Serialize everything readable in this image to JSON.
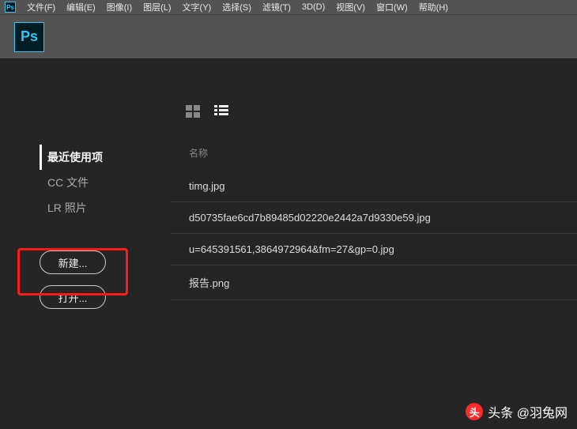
{
  "menubar": {
    "logo": "Ps",
    "items": [
      "文件(F)",
      "编辑(E)",
      "图像(I)",
      "图层(L)",
      "文字(Y)",
      "选择(S)",
      "滤镜(T)",
      "3D(D)",
      "视图(V)",
      "窗口(W)",
      "帮助(H)"
    ]
  },
  "toolbar": {
    "logo": "Ps"
  },
  "sidebar": {
    "nav": [
      {
        "label": "最近使用项",
        "active": true
      },
      {
        "label": "CC 文件",
        "active": false
      },
      {
        "label": "LR 照片",
        "active": false
      }
    ],
    "buttons": {
      "new": "新建...",
      "open": "打开..."
    }
  },
  "content": {
    "column_header": "名称",
    "files": [
      "timg.jpg",
      "d50735fae6cd7b89485d02220e2442a7d9330e59.jpg",
      "u=645391561,3864972964&fm=27&gp=0.jpg",
      "报告.png"
    ]
  },
  "watermark": {
    "badge": "头",
    "text": "头条 @羽兔网"
  }
}
